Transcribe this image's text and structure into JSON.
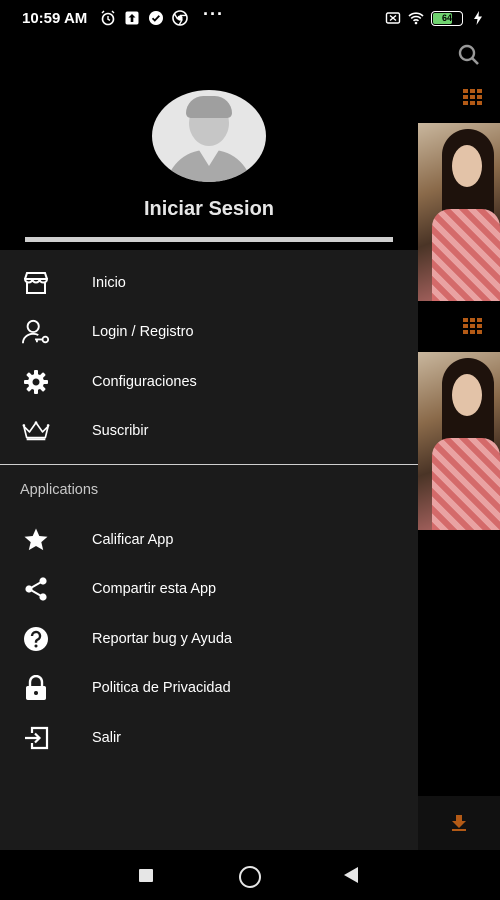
{
  "status_bar": {
    "time": "10:59 AM",
    "battery": "64",
    "left_icons": [
      "alarm-icon",
      "upload-icon",
      "check-circle-icon",
      "chrome-icon"
    ],
    "right_icons": [
      "sim-off-icon",
      "wifi-icon",
      "battery-icon",
      "charging-icon"
    ]
  },
  "drawer": {
    "header": {
      "title": "Iniciar Sesion",
      "avatar_icon": "user-avatar-icon"
    },
    "menu": [
      {
        "label": "Inicio",
        "icon": "store-icon"
      },
      {
        "label": "Login / Registro",
        "icon": "user-key-icon"
      },
      {
        "label": "Configuraciones",
        "icon": "gear-icon"
      },
      {
        "label": "Suscribir",
        "icon": "crown-icon"
      }
    ],
    "section_title": "Applications",
    "app_menu": [
      {
        "label": "Calificar App",
        "icon": "star-icon"
      },
      {
        "label": "Compartir esta App",
        "icon": "share-icon"
      },
      {
        "label": "Reportar bug y Ayuda",
        "icon": "help-icon"
      },
      {
        "label": "Politica de Privacidad",
        "icon": "lock-icon"
      },
      {
        "label": "Salir",
        "icon": "exit-icon"
      }
    ]
  },
  "background": {
    "icons": [
      "search-icon",
      "grid-icon",
      "download-icon"
    ],
    "accent": "#b35a16"
  },
  "colors": {
    "drawer_bg": "#1b1b1b",
    "header_bg": "#000000",
    "text": "#ffffff"
  }
}
